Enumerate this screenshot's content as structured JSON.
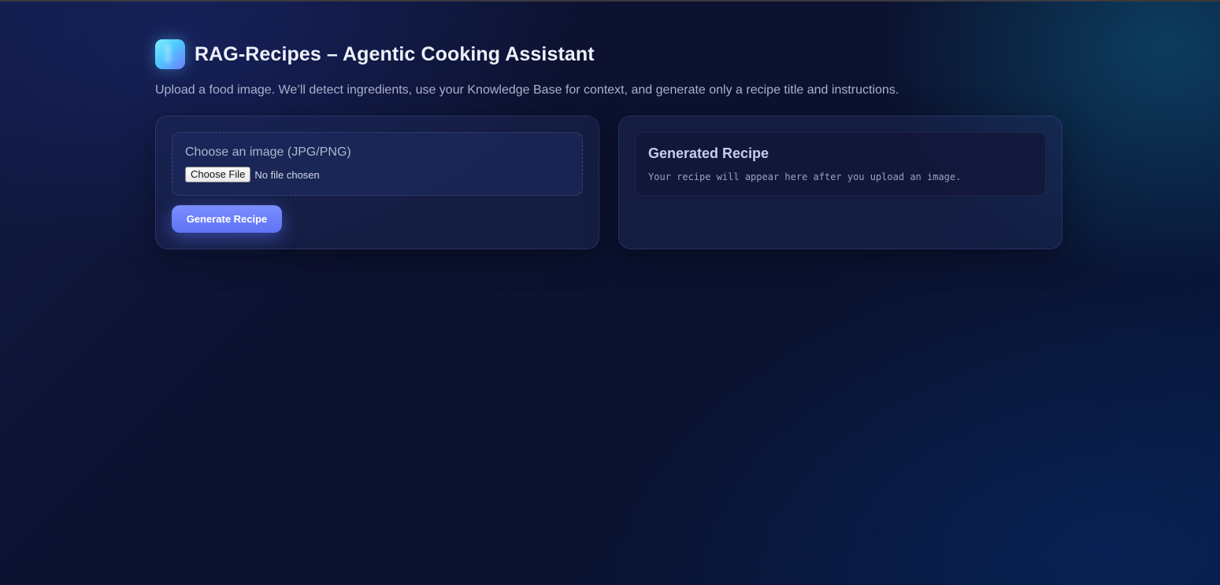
{
  "app": {
    "title": "RAG-Recipes – Agentic Cooking Assistant",
    "logo_icon": "app-logo-icon",
    "subtitle": "Upload a food image. We’ll detect ingredients, use your Knowledge Base for context, and generate only a recipe title and instructions."
  },
  "upload": {
    "label": "Choose an image (JPG/PNG)",
    "choose_file_label": "Choose File",
    "file_status": "No file chosen",
    "generate_label": "Generate Recipe"
  },
  "output": {
    "title": "Generated Recipe",
    "placeholder": "Your recipe will appear here after you upload an image."
  },
  "colors": {
    "accent": "#6f82fb",
    "background": "#0c1230",
    "logo_gradient_start": "#7ff0ff",
    "logo_gradient_end": "#6f7dff"
  }
}
